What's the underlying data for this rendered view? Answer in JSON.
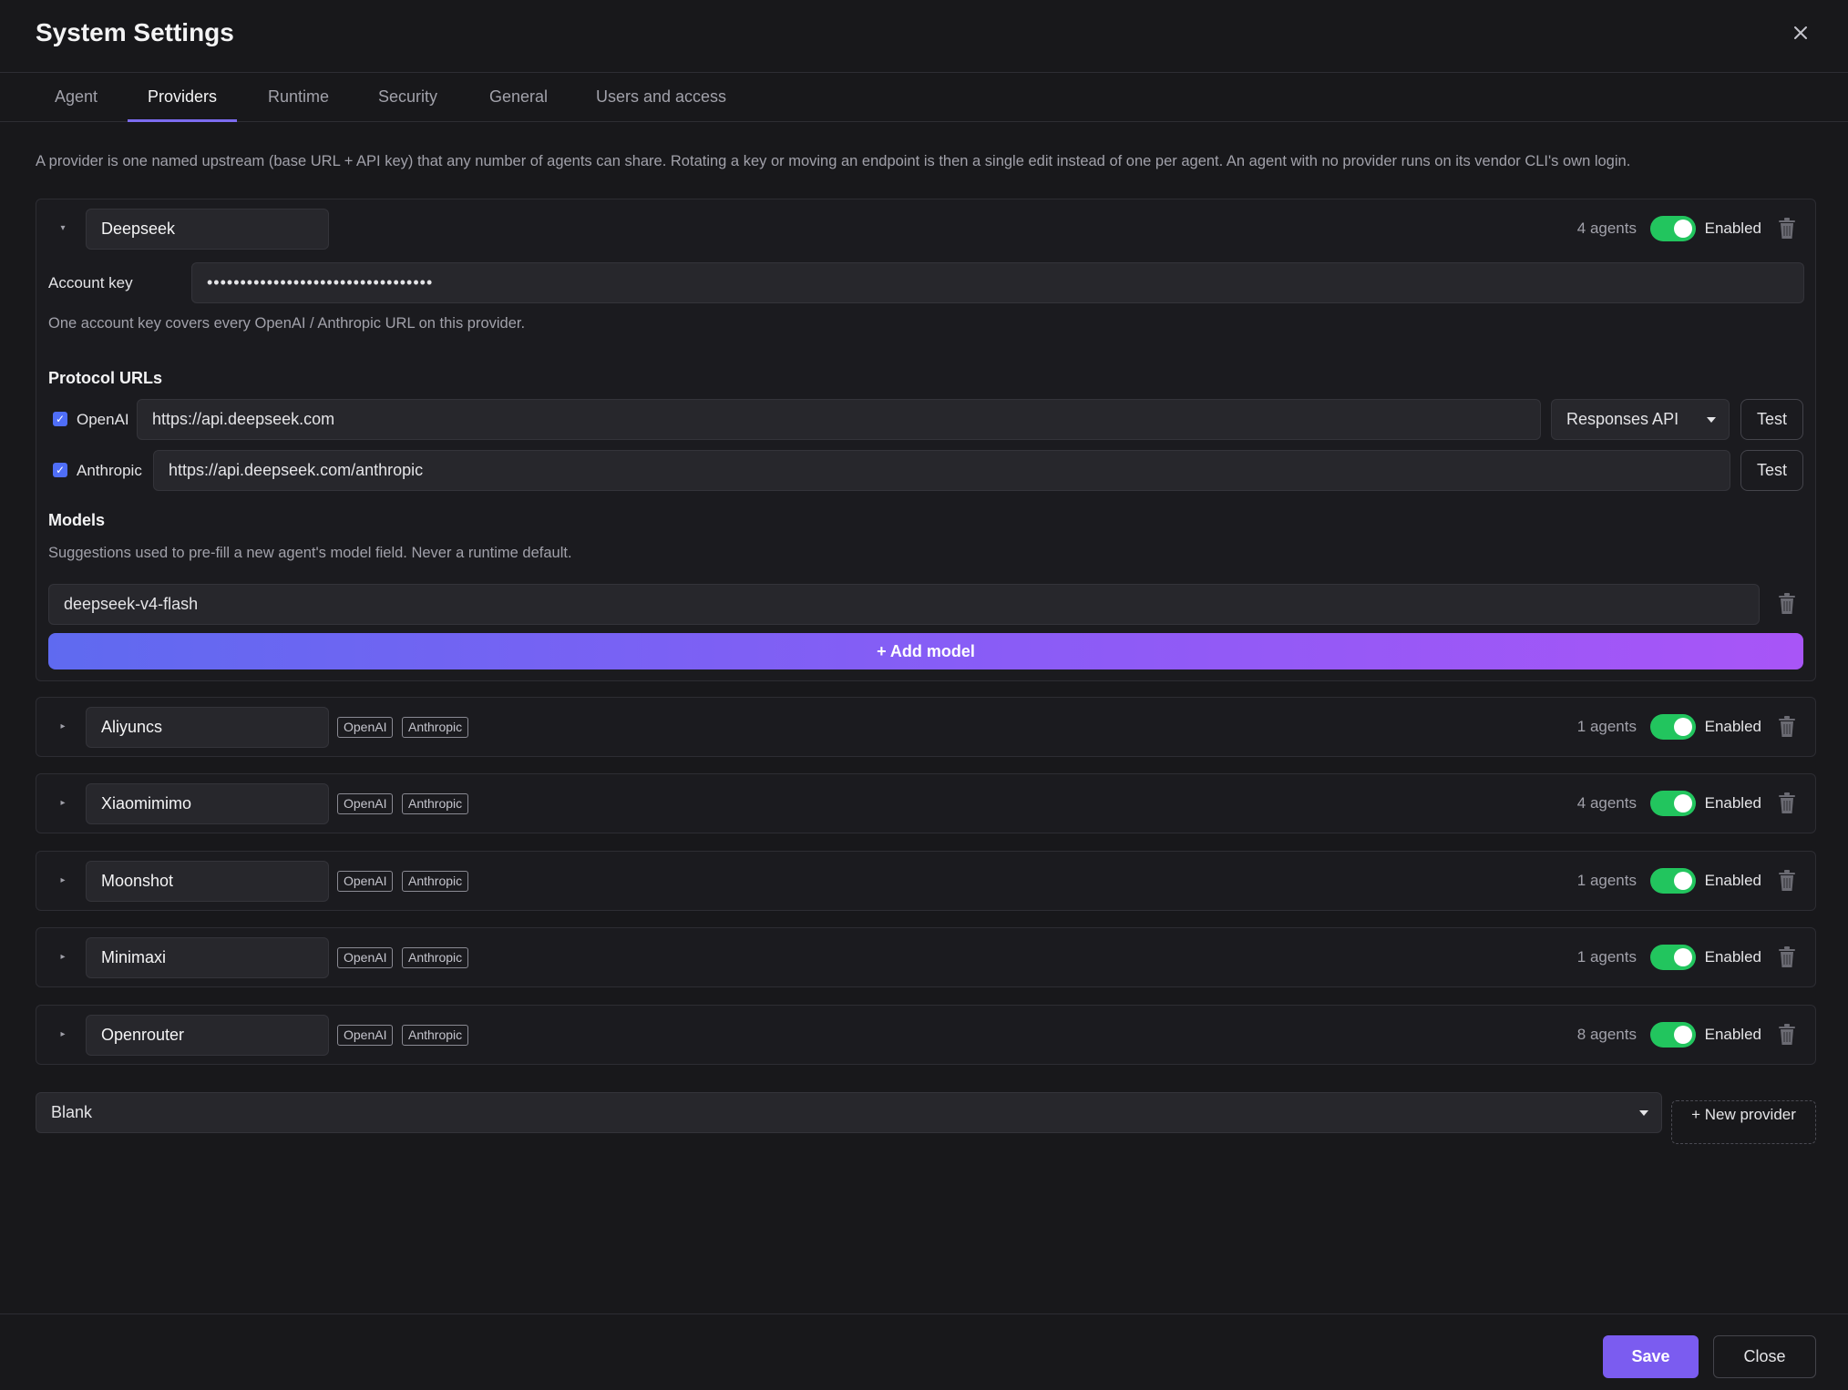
{
  "window": {
    "title": "System Settings"
  },
  "tabs": [
    {
      "label": "Agent"
    },
    {
      "label": "Providers"
    },
    {
      "label": "Runtime"
    },
    {
      "label": "Security"
    },
    {
      "label": "General"
    },
    {
      "label": "Users and access"
    }
  ],
  "intro": "A provider is one named upstream (base URL + API key) that any number of agents can share. Rotating a key or moving an endpoint is then a single edit instead of one per agent. An agent with no provider runs on its vendor CLI's own login.",
  "expanded": {
    "name": "Deepseek",
    "agents": "4 agents",
    "enabled_label": "Enabled",
    "account_key_label": "Account key",
    "account_key_value": "••••••••••••••••••••••••••••••••••",
    "account_key_help": "One account key covers every OpenAI / Anthropic URL on this provider.",
    "protocol_title": "Protocol URLs",
    "openai_label": "OpenAI",
    "openai_url": "https://api.deepseek.com",
    "openai_api_mode": "Responses API",
    "anthropic_label": "Anthropic",
    "anthropic_url": "https://api.deepseek.com/anthropic",
    "test_label": "Test",
    "models_title": "Models",
    "models_help": "Suggestions used to pre-fill a new agent's model field. Never a runtime default.",
    "model_value": "deepseek-v4-flash",
    "add_model_label": "+ Add model"
  },
  "providers": [
    {
      "name": "Aliyuncs",
      "agents": "1 agents",
      "badges": [
        "OpenAI",
        "Anthropic"
      ],
      "enabled_label": "Enabled"
    },
    {
      "name": "Xiaomimimo",
      "agents": "4 agents",
      "badges": [
        "OpenAI",
        "Anthropic"
      ],
      "enabled_label": "Enabled"
    },
    {
      "name": "Moonshot",
      "agents": "1 agents",
      "badges": [
        "OpenAI",
        "Anthropic"
      ],
      "enabled_label": "Enabled"
    },
    {
      "name": "Minimaxi",
      "agents": "1 agents",
      "badges": [
        "OpenAI",
        "Anthropic"
      ],
      "enabled_label": "Enabled"
    },
    {
      "name": "Openrouter",
      "agents": "8 agents",
      "badges": [
        "OpenAI",
        "Anthropic"
      ],
      "enabled_label": "Enabled"
    }
  ],
  "template_select": "Blank",
  "new_provider_label": "+ New provider",
  "footer": {
    "save_label": "Save",
    "close_label": "Close"
  },
  "colors": {
    "accent": "#7b5cf0",
    "toggle_on": "#22c55e",
    "background": "#18181b"
  }
}
